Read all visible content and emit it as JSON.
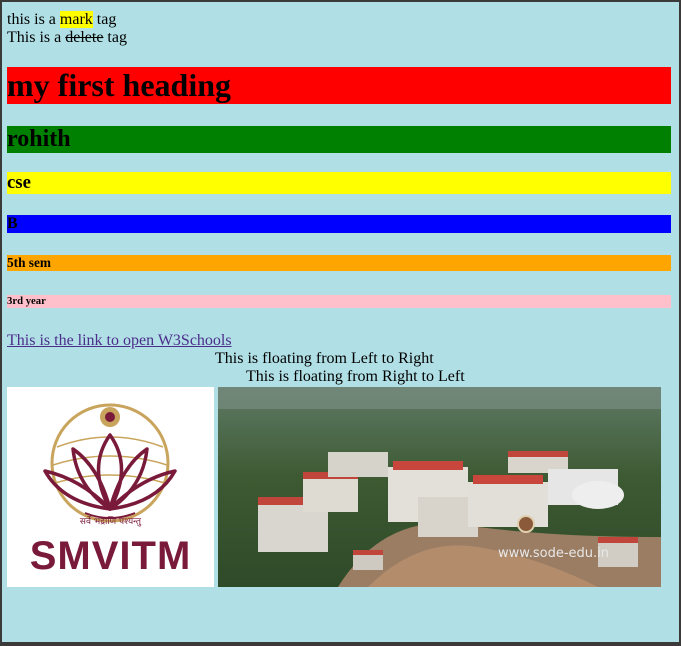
{
  "mark_line": {
    "prefix": "this is a ",
    "marked": "mark",
    "suffix": " tag"
  },
  "delete_line": {
    "prefix": "This is a ",
    "deleted": "delete",
    "suffix": " tag"
  },
  "headings": {
    "h1": "my first heading",
    "h2": "rohith",
    "h3": "cse",
    "h4": "B",
    "h5": "5th sem",
    "h6": "3rd year"
  },
  "link": {
    "text": "This is the link to open W3Schools"
  },
  "marquees": {
    "left_to_right": "This is floating from Left to Right",
    "right_to_left": "This is floating from Right to Left"
  },
  "logo": {
    "brand": "SMVITM",
    "tagline": "सर्वे भद्राणि पश्यन्तु"
  },
  "campus_image": {
    "watermark": "www.sode-edu.in"
  },
  "colors": {
    "page_background": "#b0e0e6",
    "h1_bg": "#ff0000",
    "h2_bg": "#008000",
    "h3_bg": "#ffff00",
    "h4_bg": "#0000ff",
    "h5_bg": "#ffa500",
    "h6_bg": "#ffc0cb",
    "logo_maroon": "#7a1a3a",
    "logo_gold": "#c9a45c"
  }
}
